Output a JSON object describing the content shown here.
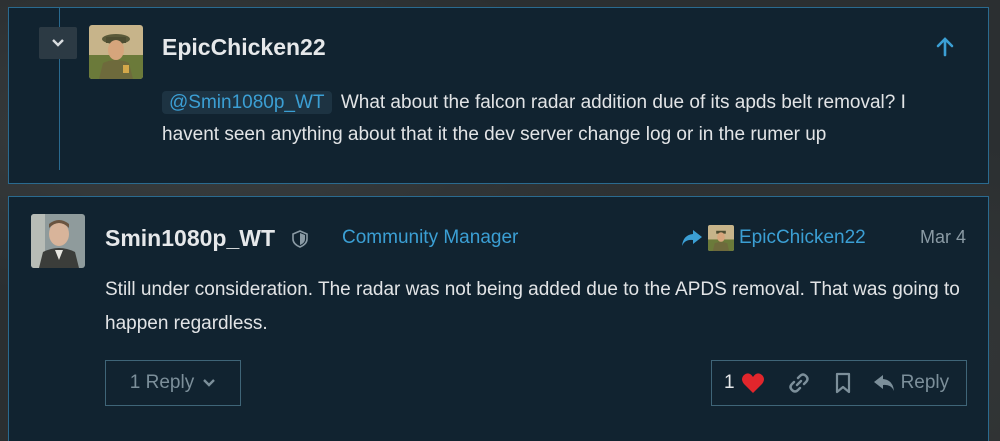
{
  "parent_post": {
    "username": "EpicChicken22",
    "mention": "@Smin1080p_WT",
    "body": "What about the falcon radar addition due of its apds belt removal? I havent seen anything about that it the dev server change log or in the rumer up"
  },
  "reply_post": {
    "username": "Smin1080p_WT",
    "title": "Community Manager",
    "reply_to_user": "EpicChicken22",
    "date": "Mar 4",
    "body": "Still under consideration. The radar was not being added due to the APDS removal. That was going to happen regardless.",
    "replies_label": "1 Reply",
    "like_count": "1",
    "reply_label": "Reply"
  },
  "colors": {
    "accent": "#3b9fd4",
    "border": "#2a6a8f",
    "post_bg": "#112330",
    "like": "#e2262c"
  },
  "icons": [
    "chevron-down-icon",
    "arrow-up-icon",
    "shield-icon",
    "share-arrow-icon",
    "heart-icon",
    "link-icon",
    "bookmark-icon",
    "reply-icon"
  ]
}
